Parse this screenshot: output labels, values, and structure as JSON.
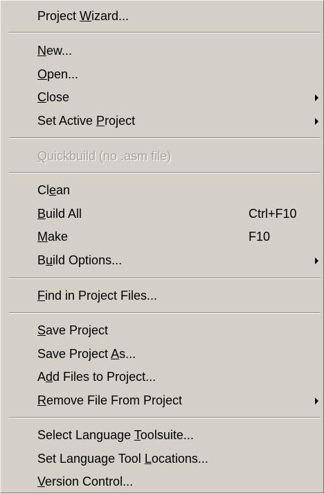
{
  "menu": {
    "groups": [
      {
        "items": [
          {
            "label": "Project Wizard...",
            "underline_index": 8,
            "enabled": true,
            "submenu": false
          }
        ]
      },
      {
        "items": [
          {
            "label": "New...",
            "underline_index": 0,
            "enabled": true,
            "submenu": false
          },
          {
            "label": "Open...",
            "underline_index": 0,
            "enabled": true,
            "submenu": false
          },
          {
            "label": "Close",
            "underline_index": 0,
            "enabled": true,
            "submenu": true
          },
          {
            "label": "Set Active Project",
            "underline_index": 11,
            "enabled": true,
            "submenu": true
          }
        ]
      },
      {
        "items": [
          {
            "label": "Quickbuild (no .asm file)",
            "underline_index": 0,
            "enabled": false,
            "submenu": false
          }
        ]
      },
      {
        "items": [
          {
            "label": "Clean",
            "underline_index": 2,
            "enabled": true,
            "submenu": false
          },
          {
            "label": "Build All",
            "underline_index": 0,
            "enabled": true,
            "submenu": false,
            "shortcut": "Ctrl+F10"
          },
          {
            "label": "Make",
            "underline_index": 0,
            "enabled": true,
            "submenu": false,
            "shortcut": "F10"
          },
          {
            "label": "Build Options...",
            "underline_index": 1,
            "enabled": true,
            "submenu": true
          }
        ]
      },
      {
        "items": [
          {
            "label": "Find in Project Files...",
            "underline_index": 0,
            "enabled": true,
            "submenu": false
          }
        ]
      },
      {
        "items": [
          {
            "label": "Save Project",
            "underline_index": 0,
            "enabled": true,
            "submenu": false
          },
          {
            "label": "Save Project As...",
            "underline_index": 13,
            "enabled": true,
            "submenu": false
          },
          {
            "label": "Add Files to Project...",
            "underline_index": 1,
            "enabled": true,
            "submenu": false
          },
          {
            "label": "Remove File From Project",
            "underline_index": 0,
            "enabled": true,
            "submenu": true
          }
        ]
      },
      {
        "items": [
          {
            "label": "Select Language Toolsuite...",
            "underline_index": 16,
            "enabled": true,
            "submenu": false
          },
          {
            "label": "Set Language Tool Locations...",
            "underline_index": 18,
            "enabled": true,
            "submenu": false
          },
          {
            "label": "Version Control...",
            "underline_index": 0,
            "enabled": true,
            "submenu": false
          }
        ]
      }
    ]
  }
}
